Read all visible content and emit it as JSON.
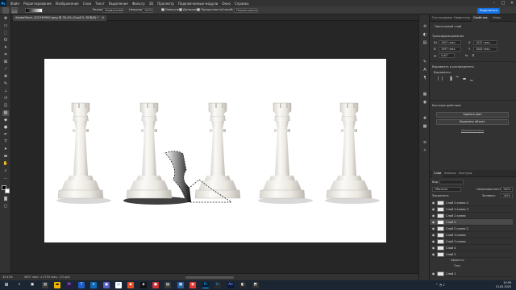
{
  "menubar": {
    "logo": "Ps",
    "items": [
      "Файл",
      "Редактирование",
      "Изображение",
      "Слои",
      "Текст",
      "Выделение",
      "Фильтр",
      "3D",
      "Просмотр",
      "Подключаемые модули",
      "Окно",
      "Справка"
    ],
    "minimize": "–",
    "maximize": "□",
    "close": "✕"
  },
  "options": {
    "mode_label": "Режим:",
    "mode_value": "Нормальный",
    "opacity_label": "Непрозр.:",
    "opacity_value": "100%",
    "inverse": "Инверсия",
    "dither": "Дизеринг",
    "transparency": "Прозрачность",
    "method_label": "Способ:",
    "method_value": "Перцепционный",
    "share": "Поделиться"
  },
  "document": {
    "tab_title": "AdobeStock_202749950.jpeg @ 35,4% (Слой 5, RGB/8) *",
    "tab_close": "✕"
  },
  "status": {
    "zoom": "35,43%",
    "size": "5607 пикс. x 2753 пикс. (72 ppi)"
  },
  "panel_tabs": [
    "Гистограмма",
    "Навигатор",
    "Свойства",
    "Инфо"
  ],
  "properties": {
    "layer_kind": "Пиксельный слой",
    "transform_title": "Трансформирование",
    "w_label": "Ш",
    "w_value": "1007 пикс.",
    "x_label": "X",
    "x_value": "1032 пикс.",
    "h_label": "В",
    "h_value": "1997 пикс.",
    "y_label": "Y",
    "y_value": "1000 пикс.",
    "angle_value": "0,00°",
    "align_title": "Выровнять и распределить",
    "align_sub": "Выровнять:",
    "quick_title": "Быстрые действия",
    "btn_remove_bg": "Удалить фон",
    "btn_select_subject": "Выделить объект",
    "more": "Дополнительно"
  },
  "layers_panel": {
    "tabs": [
      "Слои",
      "Каналы",
      "Контуры"
    ],
    "kind_label": "Вид",
    "blend": "Обычные",
    "opacity_label": "Непрозрачность:",
    "opacity_value": "100%",
    "lock_label": "Закрепить:",
    "fill_label": "Заливка:",
    "fill_value": "100%",
    "layers": [
      {
        "name": "Слой 2 копия 4",
        "selected": false
      },
      {
        "name": "Слой 2 копия 3",
        "selected": false
      },
      {
        "name": "Слой 2 копия",
        "selected": false
      },
      {
        "name": "Слой 5",
        "selected": true
      },
      {
        "name": "Слой 2 копия 2",
        "selected": false
      },
      {
        "name": "Слой 3 копия",
        "selected": false
      },
      {
        "name": "Слой 2 копия",
        "selected": false
      },
      {
        "name": "Слой 4",
        "selected": false
      },
      {
        "name": "Слой 2",
        "selected": false
      },
      {
        "name": "Слой 1",
        "selected": false
      }
    ],
    "effects_label": "Эффекты",
    "shadow_label": "Тень"
  },
  "taskbar": {
    "time": "10:56",
    "date": "13.05.2025"
  },
  "colors": {
    "accent": "#1473e6",
    "canvas_bg": "#ffffff",
    "workspace": "#262626",
    "panel": "#323232"
  }
}
